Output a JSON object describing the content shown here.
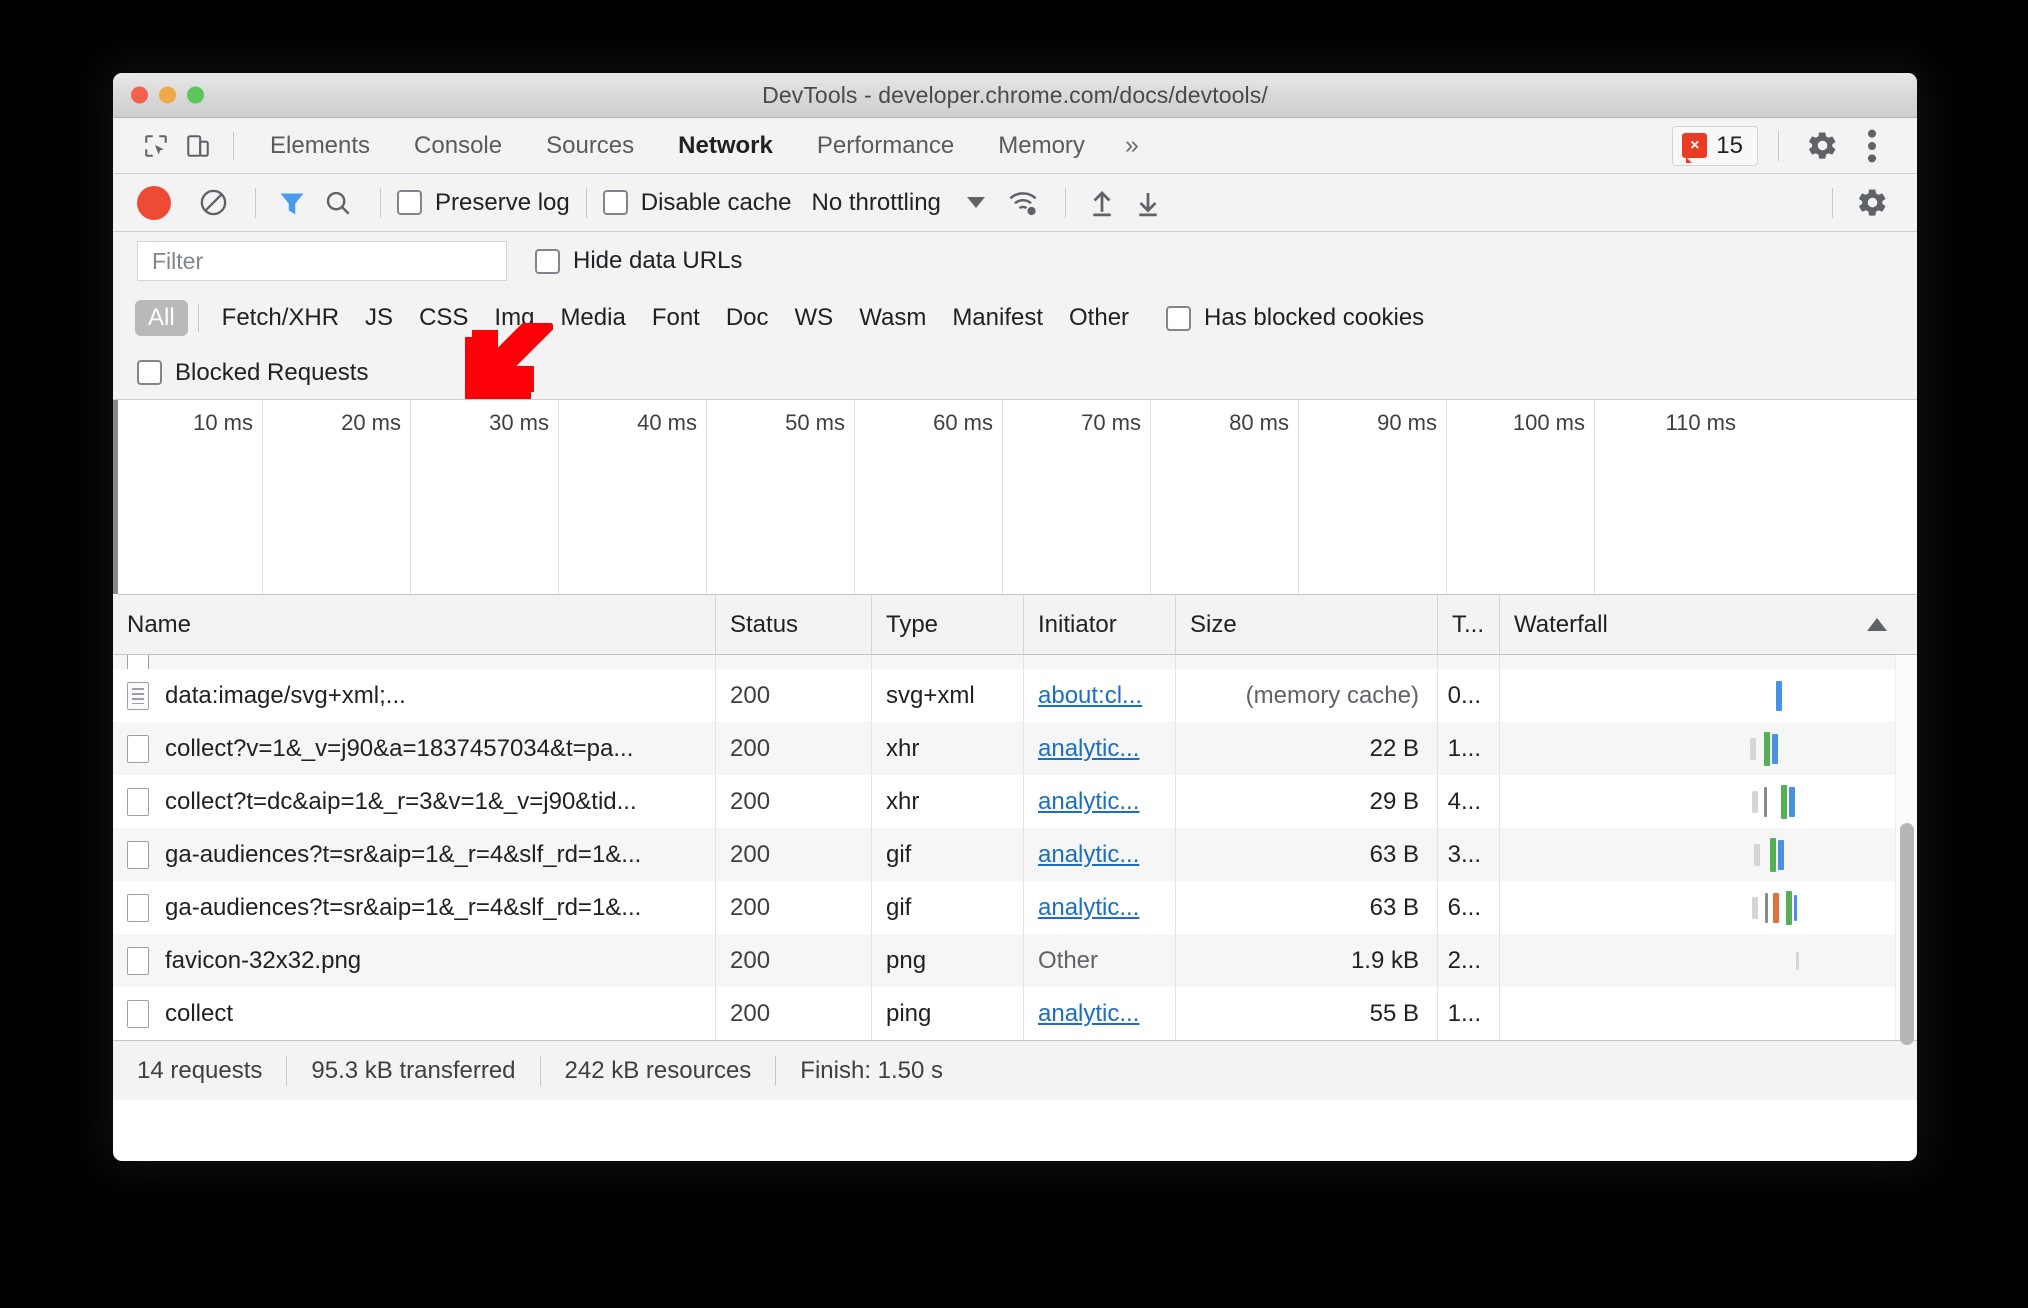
{
  "window": {
    "title": "DevTools - developer.chrome.com/docs/devtools/",
    "traffic_lights": [
      "close-red",
      "minimize-yellow",
      "maximize-green"
    ]
  },
  "tabbar": {
    "inspect_icon": "inspect-element-icon",
    "device_icon": "device-toolbar-icon",
    "tabs": [
      {
        "label": "Elements",
        "active": false
      },
      {
        "label": "Console",
        "active": false
      },
      {
        "label": "Sources",
        "active": false
      },
      {
        "label": "Network",
        "active": true
      },
      {
        "label": "Performance",
        "active": false
      },
      {
        "label": "Memory",
        "active": false
      }
    ],
    "overflow_label": "»",
    "error_badge": {
      "icon": "error-cross-icon",
      "glyph": "×",
      "count": "15",
      "color": "#ec3b24"
    },
    "settings_icon": "gear-icon",
    "more_icon": "more-vertical-dots-icon"
  },
  "network_toolbar": {
    "record_button": {
      "name": "record-button",
      "color": "#ef4a34"
    },
    "clear_icon": "clear-prohibited-icon",
    "filter_icon": "filter-funnel-icon",
    "filter_icon_active_color": "#1a73e8",
    "search_icon": "search-magnifier-icon",
    "preserve_log": {
      "label": "Preserve log",
      "checked": false
    },
    "disable_cache": {
      "label": "Disable cache",
      "checked": false
    },
    "throttling": {
      "value": "No throttling",
      "caret": "chevron-down-icon"
    },
    "wifi_icon": "wifi-settings-icon",
    "import_icon": "import-upload-arrow-icon",
    "export_icon": "export-download-arrow-icon",
    "settings_icon": "network-settings-gear-icon"
  },
  "filter_row": {
    "input_placeholder": "Filter",
    "input_value": "",
    "hide_data_urls": {
      "label": "Hide data URLs",
      "checked": false
    }
  },
  "type_chips": [
    {
      "label": "All",
      "selected": true
    },
    {
      "label": "Fetch/XHR",
      "selected": false
    },
    {
      "label": "JS",
      "selected": false
    },
    {
      "label": "CSS",
      "selected": false
    },
    {
      "label": "Img",
      "selected": false
    },
    {
      "label": "Media",
      "selected": false
    },
    {
      "label": "Font",
      "selected": false
    },
    {
      "label": "Doc",
      "selected": false
    },
    {
      "label": "WS",
      "selected": false
    },
    {
      "label": "Wasm",
      "selected": false
    },
    {
      "label": "Manifest",
      "selected": false
    },
    {
      "label": "Other",
      "selected": false
    }
  ],
  "has_blocked_cookies": {
    "label": "Has blocked cookies",
    "checked": false
  },
  "blocked_requests": {
    "label": "Blocked Requests",
    "checked": false
  },
  "annotation": {
    "type": "arrow-down-left",
    "color": "#fb0007",
    "points_to": "all-filter-chip"
  },
  "timeline": {
    "ticks": [
      "10 ms",
      "20 ms",
      "30 ms",
      "40 ms",
      "50 ms",
      "60 ms",
      "70 ms",
      "80 ms",
      "90 ms",
      "100 ms",
      "110 ms"
    ],
    "clipped_last_tick": true
  },
  "table": {
    "columns": [
      "Name",
      "Status",
      "Type",
      "Initiator",
      "Size",
      "T...",
      "Waterfall"
    ],
    "sort_column": "Waterfall",
    "sort_direction": "ascending",
    "rows": [
      {
        "name": "data:image/svg+xml;...",
        "icon": "document-file-icon",
        "status": "200",
        "type": "svg+xml",
        "initiator": "about:cl...",
        "size": "(memory cache)",
        "time": "0...",
        "waterfall": [
          "blue"
        ]
      },
      {
        "name": "collect?v=1&_v=j90&a=1837457034&t=pa...",
        "icon": "file-icon",
        "status": "200",
        "type": "xhr",
        "initiator": "analytic...",
        "size": "22 B",
        "time": "1...",
        "waterfall": [
          "gray",
          "green",
          "blue"
        ]
      },
      {
        "name": "collect?t=dc&aip=1&_r=3&v=1&_v=j90&tid...",
        "icon": "file-icon",
        "status": "200",
        "type": "xhr",
        "initiator": "analytic...",
        "size": "29 B",
        "time": "4...",
        "waterfall": [
          "gray",
          "dgray",
          "green",
          "blue"
        ]
      },
      {
        "name": "ga-audiences?t=sr&aip=1&_r=4&slf_rd=1&...",
        "icon": "file-icon",
        "status": "200",
        "type": "gif",
        "initiator": "analytic...",
        "size": "63 B",
        "time": "3...",
        "waterfall": [
          "gray",
          "green",
          "blue"
        ]
      },
      {
        "name": "ga-audiences?t=sr&aip=1&_r=4&slf_rd=1&...",
        "icon": "file-icon",
        "status": "200",
        "type": "gif",
        "initiator": "analytic...",
        "size": "63 B",
        "time": "6...",
        "waterfall": [
          "gray",
          "dgray",
          "orange",
          "green",
          "blue"
        ]
      },
      {
        "name": "favicon-32x32.png",
        "icon": "file-icon",
        "status": "200",
        "type": "png",
        "initiator": "Other",
        "size": "1.9 kB",
        "time": "2...",
        "waterfall": [
          "gray"
        ]
      },
      {
        "name": "collect",
        "icon": "file-icon",
        "status": "200",
        "type": "ping",
        "initiator": "analytic...",
        "size": "55 B",
        "time": "1...",
        "waterfall": []
      }
    ]
  },
  "statusbar": {
    "requests": "14 requests",
    "transferred": "95.3 kB transferred",
    "resources": "242 kB resources",
    "finish": "Finish: 1.50 s"
  }
}
